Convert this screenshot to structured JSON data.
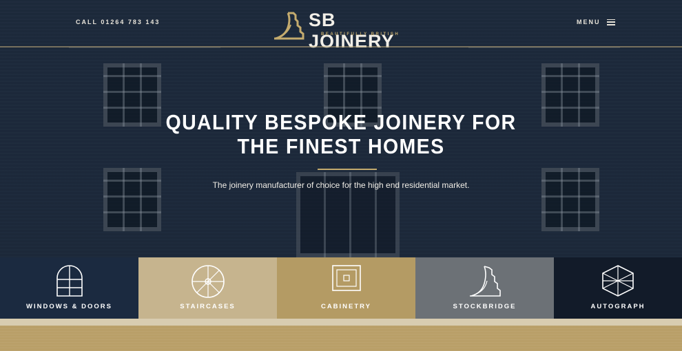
{
  "header": {
    "call": "CALL 01264 783 143",
    "logo_title": "SB JOINERY",
    "logo_tagline": "BEAUTIFULLY BRITISH",
    "menu_label": "MENU"
  },
  "hero": {
    "headline_line1": "QUALITY BESPOKE JOINERY FOR",
    "headline_line2": "THE FINEST HOMES",
    "subline": "The joinery manufacturer of choice for the high end residential market."
  },
  "tiles": [
    {
      "label": "WINDOWS & DOORS",
      "icon": "arched-window-icon",
      "color": "#1b2a40"
    },
    {
      "label": "STAIRCASES",
      "icon": "spiral-staircase-icon",
      "color": "#c6b48e"
    },
    {
      "label": "CABINETRY",
      "icon": "cabinet-panel-icon",
      "color": "#b49b64"
    },
    {
      "label": "STOCKBRIDGE",
      "icon": "stockbridge-stair-icon",
      "color": "#6c7176"
    },
    {
      "label": "AUTOGRAPH",
      "icon": "geometric-cube-icon",
      "color": "#121b29"
    }
  ],
  "colors": {
    "accent_gold": "#c4ab6e",
    "navy": "#1b2a40"
  }
}
